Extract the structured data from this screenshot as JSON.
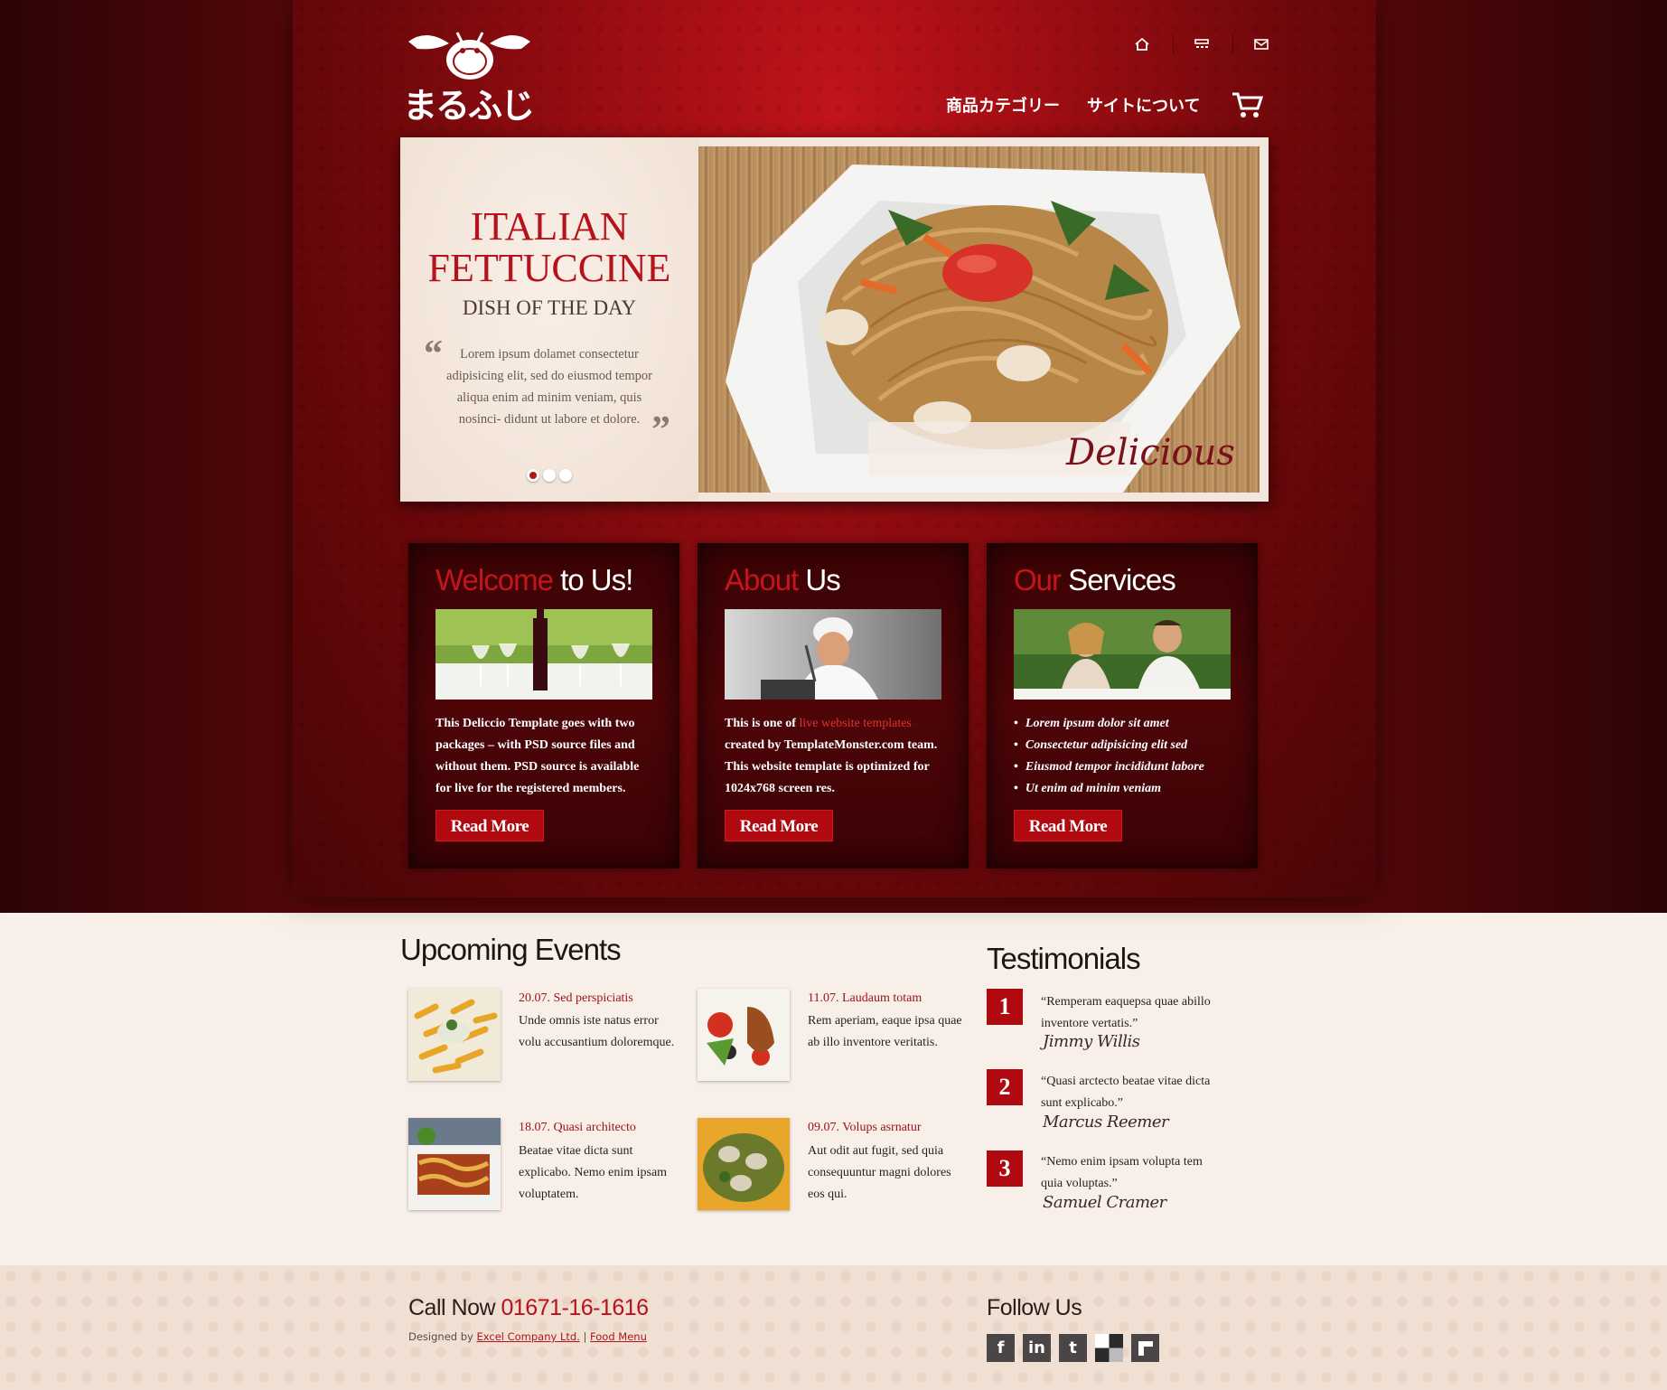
{
  "header": {
    "logo_text": "まるふじ",
    "top_icons": [
      "home-icon",
      "sitemap-icon",
      "mail-icon"
    ],
    "nav": [
      "商品カテゴリー",
      "サイトについて"
    ],
    "cart_icon": "cart-icon"
  },
  "slider": {
    "title_line1": "ITALIAN",
    "title_line2": "FETTUCCINE",
    "subtitle": "DISH OF THE DAY",
    "quote": "Lorem ipsum dolamet consectetur adipisicing elit, sed do eiusmod tempor aliqua enim ad minim veniam, quis nosinci- didunt ut labore et dolore.",
    "open_quote": "“",
    "close_quote": "”",
    "caption": "Delicious",
    "dots": 3,
    "active_dot": 0
  },
  "boxes": [
    {
      "title_hl": "Welcome",
      "title_rest": " to Us!",
      "text": "This Deliccio Template goes with two packages – with PSD source files and without them. PSD source is available for live for the registered members.",
      "button": "Read More"
    },
    {
      "title_hl": "About",
      "title_rest": " Us",
      "text_before": "This is one of ",
      "link": "live website templates",
      "text_after": " created by TemplateMonster.com team. This website template is optimized for 1024x768 screen res.",
      "button": "Read More"
    },
    {
      "title_hl": "Our",
      "title_rest": " Services",
      "items": [
        "Lorem ipsum dolor sit amet",
        "Consectetur adipisicing elit sed",
        "Eiusmod tempor incididunt labore",
        "Ut enim ad minim veniam"
      ],
      "button": "Read More"
    }
  ],
  "events": {
    "title": "Upcoming Events",
    "items": [
      {
        "date": "20.07. Sed perspiciatis",
        "text": "Unde omnis iste natus error volu accusantium doloremque."
      },
      {
        "date": "11.07. Laudaum totam",
        "text": "Rem aperiam, eaque ipsa quae ab illo inventore veritatis."
      },
      {
        "date": "18.07. Quasi architecto",
        "text": "Beatae vitae dicta sunt explicabo. Nemo enim ipsam voluptatem."
      },
      {
        "date": "09.07. Volups asrnatur",
        "text": "Aut odit aut fugit, sed quia consequuntur magni dolores eos qui."
      }
    ]
  },
  "testimonials": {
    "title": "Testimonials",
    "items": [
      {
        "num": "1",
        "quote": "“Remperam eaquepsa quae abillo inventore vertatis.”",
        "author": "Jimmy Willis"
      },
      {
        "num": "2",
        "quote": "“Quasi arctecto beatae vitae dicta sunt explicabo.”",
        "author": "Marcus Reemer"
      },
      {
        "num": "3",
        "quote": "“Nemo enim ipsam volupta tem quia voluptas.”",
        "author": "Samuel Cramer"
      }
    ]
  },
  "footer": {
    "call_label": "Call Now ",
    "phone": "01671-16-1616",
    "designed_by": "Designed by ",
    "company": "Excel Company Ltd.",
    "separator": " | ",
    "food_menu": "Food Menu",
    "follow": "Follow Us",
    "social": [
      {
        "icon": "facebook-icon",
        "glyph": "f"
      },
      {
        "icon": "linkedin-icon",
        "glyph": "in"
      },
      {
        "icon": "twitter-icon",
        "glyph": "t"
      },
      {
        "icon": "delicious-icon",
        "glyph": ""
      },
      {
        "icon": "myspace-icon",
        "glyph": ""
      }
    ]
  },
  "colors": {
    "accent": "#b5121b",
    "button": "#b0090f",
    "panel": "#9b0d12",
    "background": "#f8efe8"
  }
}
